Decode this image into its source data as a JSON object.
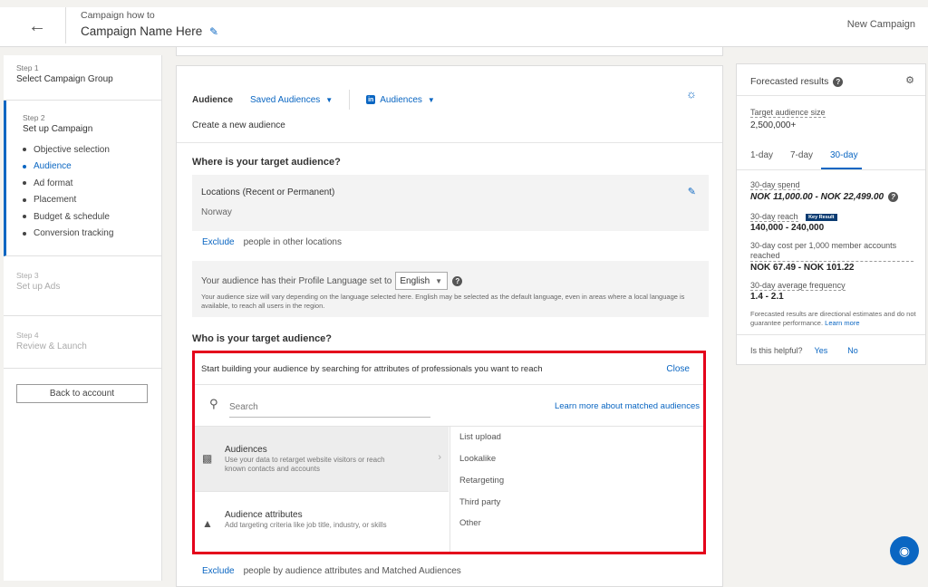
{
  "header": {
    "back_icon": "arrow-left-icon",
    "subtitle": "Campaign how to",
    "title": "Campaign Name Here",
    "edit_icon": "pencil-icon",
    "new_campaign": "New Campaign"
  },
  "sidebar": {
    "step1": {
      "num": "Step 1",
      "name": "Select Campaign Group"
    },
    "step2": {
      "num": "Step 2",
      "name": "Set up Campaign",
      "items": [
        {
          "label": "Objective selection",
          "active": false
        },
        {
          "label": "Audience",
          "active": true
        },
        {
          "label": "Ad format",
          "active": false
        },
        {
          "label": "Placement",
          "active": false
        },
        {
          "label": "Budget & schedule",
          "active": false
        },
        {
          "label": "Conversion tracking",
          "active": false
        }
      ]
    },
    "step3": {
      "num": "Step 3",
      "name": "Set up Ads"
    },
    "step4": {
      "num": "Step 4",
      "name": "Review & Launch"
    },
    "back_button": "Back to account"
  },
  "audience": {
    "label": "Audience",
    "saved_audiences": "Saved Audiences",
    "li_logo": "in",
    "audiences_dropdown": "Audiences",
    "create_new": "Create a new audience",
    "where_question": "Where is your target audience?",
    "locations_title": "Locations (Recent or Permanent)",
    "locations_value": "Norway",
    "exclude_link": "Exclude",
    "exclude_locations_text": "people in other locations",
    "language_text": "Your audience has their Profile Language set to",
    "language_value": "English",
    "help_glyph": "?",
    "language_note": "Your audience size will vary depending on the language selected here. English may be selected as the default language, even in areas where a local language is available, to reach all users in the region.",
    "who_question": "Who is your target audience?",
    "exclude_attributes_text": "people by audience attributes and Matched Audiences"
  },
  "builder": {
    "heading": "Start building your audience by searching for attributes of professionals you want to reach",
    "close": "Close",
    "search_placeholder": "Search",
    "learn_more": "Learn more about matched audiences",
    "categories": [
      {
        "title": "Audiences",
        "desc": "Use your data to retarget website visitors or reach known contacts and accounts",
        "icon": "people-group-icon"
      },
      {
        "title": "Audience attributes",
        "desc": "Add targeting criteria like job title, industry, or skills",
        "icon": "shapes-icon"
      }
    ],
    "sub_items": [
      "List upload",
      "Lookalike",
      "Retargeting",
      "Third party",
      "Other"
    ]
  },
  "forecast": {
    "title": "Forecasted results",
    "target_size_label": "Target audience size",
    "target_size_value": "2,500,000+",
    "tabs": [
      "1-day",
      "7-day",
      "30-day"
    ],
    "active_tab": "30-day",
    "spend_label": "30-day spend",
    "spend_value": "NOK 11,000.00 - NOK 22,499.00",
    "reach_label": "30-day reach",
    "key_result": "Key Result",
    "reach_value": "140,000 - 240,000",
    "cpm_label": "30-day cost per 1,000 member accounts reached",
    "cpm_value": "NOK 67.49 - NOK 101.22",
    "freq_label": "30-day average frequency",
    "freq_value": "1.4 - 2.1",
    "note": "Forecasted results are directional estimates and do not guarantee performance.",
    "learn_more": "Learn more",
    "helpful_q": "Is this helpful?",
    "yes": "Yes",
    "no": "No"
  },
  "colors": {
    "accent": "#0a66c2",
    "highlight": "#e4001b"
  }
}
